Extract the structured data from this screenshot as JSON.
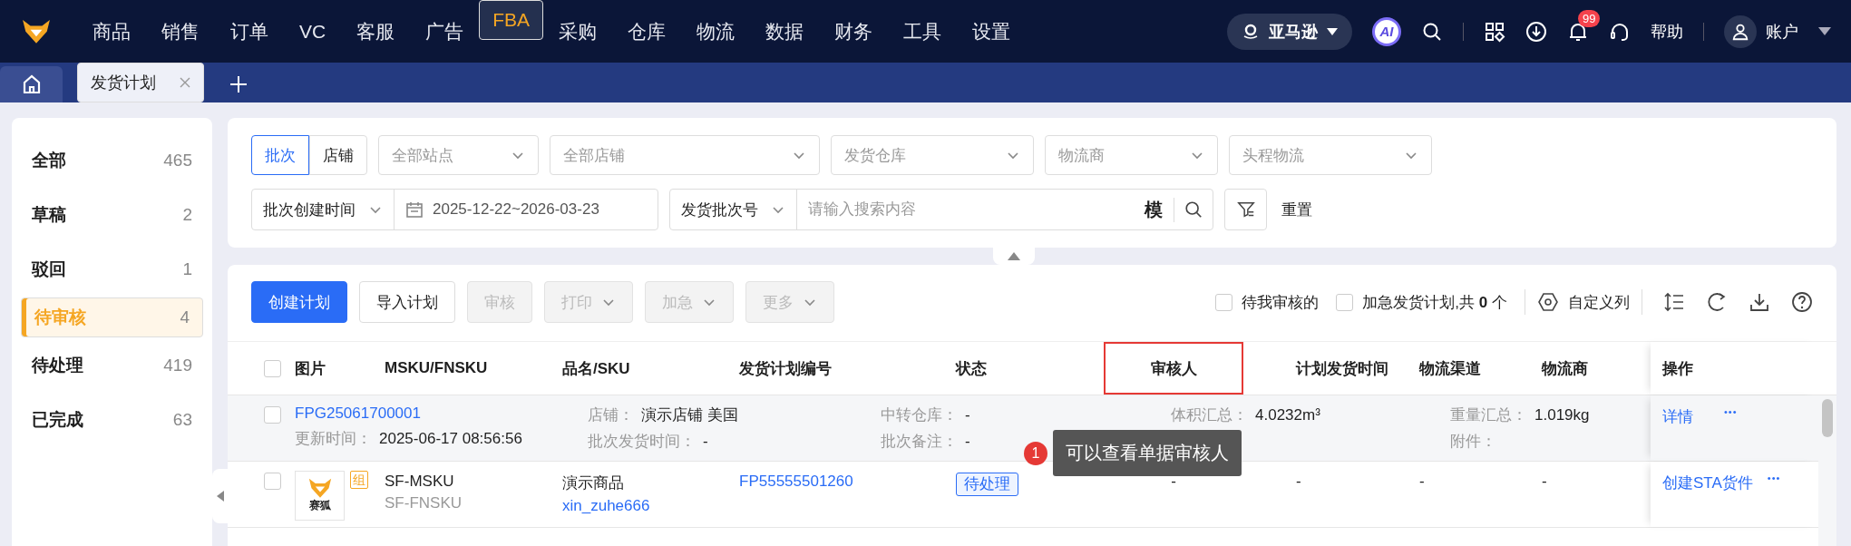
{
  "nav": {
    "menu": [
      {
        "label": "商品",
        "selected": false
      },
      {
        "label": "销售",
        "selected": false
      },
      {
        "label": "订单",
        "selected": false
      },
      {
        "label": "VC",
        "selected": false
      },
      {
        "label": "客服",
        "selected": false
      },
      {
        "label": "广告",
        "selected": false
      },
      {
        "label": "FBA",
        "selected": true
      },
      {
        "label": "采购",
        "selected": false
      },
      {
        "label": "仓库",
        "selected": false
      },
      {
        "label": "物流",
        "selected": false
      },
      {
        "label": "数据",
        "selected": false
      },
      {
        "label": "财务",
        "selected": false
      },
      {
        "label": "工具",
        "selected": false
      },
      {
        "label": "设置",
        "selected": false
      }
    ],
    "store": "亚马逊",
    "ai": "AI",
    "notifications": "99",
    "help": "帮助",
    "account": "账户"
  },
  "tabs": [
    {
      "kind": "home",
      "selected": false
    },
    {
      "kind": "page",
      "label": "发货计划",
      "selected": true
    }
  ],
  "sidebar": [
    {
      "label": "全部",
      "count": "465",
      "selected": false
    },
    {
      "label": "草稿",
      "count": "2",
      "selected": false
    },
    {
      "label": "驳回",
      "count": "1",
      "selected": false
    },
    {
      "label": "待审核",
      "count": "4",
      "selected": true
    },
    {
      "label": "待处理",
      "count": "419",
      "selected": false
    },
    {
      "label": "已完成",
      "count": "63",
      "selected": false
    }
  ],
  "filters": {
    "mode": [
      {
        "label": "批次",
        "selected": true
      },
      {
        "label": "店铺",
        "selected": false
      }
    ],
    "selects": [
      {
        "placeholder": "全部站点"
      },
      {
        "placeholder": "全部店铺"
      },
      {
        "placeholder": "发货仓库"
      },
      {
        "placeholder": "物流商"
      },
      {
        "placeholder": "头程物流"
      }
    ],
    "date_field": {
      "label": "批次创建时间",
      "value": "2025-12-22~2026-03-23"
    },
    "search": {
      "field": "发货批次号",
      "placeholder": "请输入搜索内容",
      "match": "模"
    },
    "reset": "重置"
  },
  "toolbar": {
    "buttons": [
      {
        "label": "创建计划",
        "kind": "primary",
        "disabled": false,
        "dropdown": false
      },
      {
        "label": "导入计划",
        "kind": "default",
        "disabled": false,
        "dropdown": false
      },
      {
        "label": "审核",
        "kind": "default",
        "disabled": true,
        "dropdown": false
      },
      {
        "label": "打印",
        "kind": "default",
        "disabled": true,
        "dropdown": true
      },
      {
        "label": "加急",
        "kind": "default",
        "disabled": true,
        "dropdown": true
      },
      {
        "label": "更多",
        "kind": "default",
        "disabled": true,
        "dropdown": true
      }
    ],
    "checks": [
      {
        "label": "待我审核的",
        "checked": false
      },
      {
        "label": "加急发货计划,共 **0** 个",
        "checked": false
      }
    ],
    "columns_button": "自定义列"
  },
  "table": {
    "all_checked": false,
    "columns": [
      {
        "label": "图片",
        "highlighted": false
      },
      {
        "label": "MSKU/FNSKU",
        "highlighted": false
      },
      {
        "label": "品名/SKU",
        "highlighted": false
      },
      {
        "label": "发货计划编号",
        "highlighted": false
      },
      {
        "label": "状态",
        "highlighted": false
      },
      {
        "label": "审核人",
        "highlighted": true
      },
      {
        "label": "计划发货时间",
        "highlighted": false
      },
      {
        "label": "物流渠道",
        "highlighted": false
      },
      {
        "label": "物流商",
        "highlighted": false
      },
      {
        "label": "操作",
        "highlighted": false
      }
    ],
    "batch": {
      "checked": false,
      "id": "FPG25061700001",
      "blocks": [
        [
          [
            "更新时间：",
            "2025-06-17 08:56:56"
          ]
        ],
        [
          [
            "店铺：",
            "演示店铺 美国"
          ],
          [
            "批次发货时间：",
            "-"
          ]
        ],
        [
          [
            "中转仓库：",
            "-"
          ],
          [
            "批次备注：",
            "-"
          ]
        ],
        [
          [
            "体积汇总：",
            "4.0232m³"
          ]
        ],
        [
          [
            "重量汇总：",
            "1.019kg"
          ],
          [
            "附件："
          ]
        ]
      ],
      "action": "详情",
      "more": "•••"
    },
    "rows": [
      {
        "checked": false,
        "badge": "组",
        "color": "#f5a623",
        "thumb": "赛狐",
        "msku": "SF-MSKU",
        "fnsku": "SF-FNSKU",
        "name": "演示商品",
        "sku": "xin_zuhe666",
        "plan_no": "FP55555501260",
        "status": "待处理",
        "reviewer": "-",
        "ship_time": "-",
        "channel": "-",
        "carrier": "-",
        "action": "创建STA货件",
        "more": "•••"
      }
    ]
  },
  "annotation": {
    "number": "1",
    "text": "可以查看单据审核人"
  }
}
